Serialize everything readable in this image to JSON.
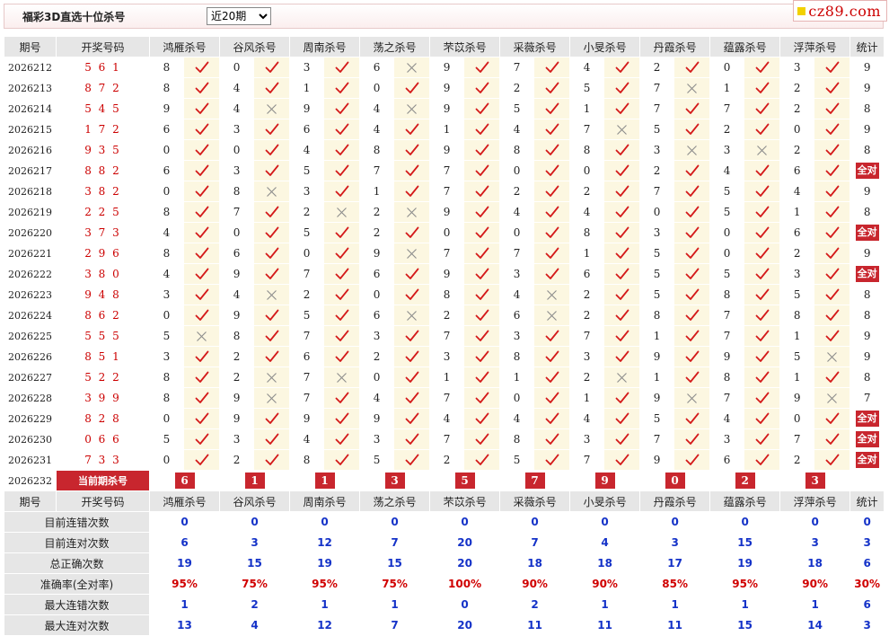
{
  "header": {
    "title": "福彩3D直选十位杀号",
    "select": {
      "selected": "近20期",
      "options": [
        "近20期"
      ]
    },
    "logo_text": "cz89.com"
  },
  "table": {
    "columns": [
      "期号",
      "开奖号码",
      "鸿雁杀号",
      "谷风杀号",
      "周南杀号",
      "荡之杀号",
      "芣苡杀号",
      "采薇杀号",
      "小旻杀号",
      "丹霞杀号",
      "蕴露杀号",
      "浮萍杀号",
      "统计"
    ],
    "full_label": "全对",
    "rows": [
      {
        "period": "2026212",
        "draw": "561",
        "kills": [
          [
            8,
            1
          ],
          [
            0,
            1
          ],
          [
            3,
            1
          ],
          [
            6,
            0
          ],
          [
            9,
            1
          ],
          [
            7,
            1
          ],
          [
            4,
            1
          ],
          [
            2,
            1
          ],
          [
            0,
            1
          ],
          [
            3,
            1
          ]
        ],
        "stat": "9"
      },
      {
        "period": "2026213",
        "draw": "872",
        "kills": [
          [
            8,
            1
          ],
          [
            4,
            1
          ],
          [
            1,
            1
          ],
          [
            0,
            1
          ],
          [
            9,
            1
          ],
          [
            2,
            1
          ],
          [
            5,
            1
          ],
          [
            7,
            0
          ],
          [
            1,
            1
          ],
          [
            2,
            1
          ]
        ],
        "stat": "9"
      },
      {
        "period": "2026214",
        "draw": "545",
        "kills": [
          [
            9,
            1
          ],
          [
            4,
            0
          ],
          [
            9,
            1
          ],
          [
            4,
            0
          ],
          [
            9,
            1
          ],
          [
            5,
            1
          ],
          [
            1,
            1
          ],
          [
            7,
            1
          ],
          [
            7,
            1
          ],
          [
            2,
            1
          ]
        ],
        "stat": "8"
      },
      {
        "period": "2026215",
        "draw": "172",
        "kills": [
          [
            6,
            1
          ],
          [
            3,
            1
          ],
          [
            6,
            1
          ],
          [
            4,
            1
          ],
          [
            1,
            1
          ],
          [
            4,
            1
          ],
          [
            7,
            0
          ],
          [
            5,
            1
          ],
          [
            2,
            1
          ],
          [
            0,
            1
          ]
        ],
        "stat": "9"
      },
      {
        "period": "2026216",
        "draw": "935",
        "kills": [
          [
            0,
            1
          ],
          [
            0,
            1
          ],
          [
            4,
            1
          ],
          [
            8,
            1
          ],
          [
            9,
            1
          ],
          [
            8,
            1
          ],
          [
            8,
            1
          ],
          [
            3,
            0
          ],
          [
            3,
            0
          ],
          [
            2,
            1
          ]
        ],
        "stat": "8"
      },
      {
        "period": "2026217",
        "draw": "882",
        "kills": [
          [
            6,
            1
          ],
          [
            3,
            1
          ],
          [
            5,
            1
          ],
          [
            7,
            1
          ],
          [
            7,
            1
          ],
          [
            0,
            1
          ],
          [
            0,
            1
          ],
          [
            2,
            1
          ],
          [
            4,
            1
          ],
          [
            6,
            1
          ]
        ],
        "stat": "全对"
      },
      {
        "period": "2026218",
        "draw": "382",
        "kills": [
          [
            0,
            1
          ],
          [
            8,
            0
          ],
          [
            3,
            1
          ],
          [
            1,
            1
          ],
          [
            7,
            1
          ],
          [
            2,
            1
          ],
          [
            2,
            1
          ],
          [
            7,
            1
          ],
          [
            5,
            1
          ],
          [
            4,
            1
          ]
        ],
        "stat": "9"
      },
      {
        "period": "2026219",
        "draw": "225",
        "kills": [
          [
            8,
            1
          ],
          [
            7,
            1
          ],
          [
            2,
            0
          ],
          [
            2,
            0
          ],
          [
            9,
            1
          ],
          [
            4,
            1
          ],
          [
            4,
            1
          ],
          [
            0,
            1
          ],
          [
            5,
            1
          ],
          [
            1,
            1
          ]
        ],
        "stat": "8"
      },
      {
        "period": "2026220",
        "draw": "373",
        "kills": [
          [
            4,
            1
          ],
          [
            0,
            1
          ],
          [
            5,
            1
          ],
          [
            2,
            1
          ],
          [
            0,
            1
          ],
          [
            0,
            1
          ],
          [
            8,
            1
          ],
          [
            3,
            1
          ],
          [
            0,
            1
          ],
          [
            6,
            1
          ]
        ],
        "stat": "全对"
      },
      {
        "period": "2026221",
        "draw": "296",
        "kills": [
          [
            8,
            1
          ],
          [
            6,
            1
          ],
          [
            0,
            1
          ],
          [
            9,
            0
          ],
          [
            7,
            1
          ],
          [
            7,
            1
          ],
          [
            1,
            1
          ],
          [
            5,
            1
          ],
          [
            0,
            1
          ],
          [
            2,
            1
          ]
        ],
        "stat": "9"
      },
      {
        "period": "2026222",
        "draw": "380",
        "kills": [
          [
            4,
            1
          ],
          [
            9,
            1
          ],
          [
            7,
            1
          ],
          [
            6,
            1
          ],
          [
            9,
            1
          ],
          [
            3,
            1
          ],
          [
            6,
            1
          ],
          [
            5,
            1
          ],
          [
            5,
            1
          ],
          [
            3,
            1
          ]
        ],
        "stat": "全对"
      },
      {
        "period": "2026223",
        "draw": "948",
        "kills": [
          [
            3,
            1
          ],
          [
            4,
            0
          ],
          [
            2,
            1
          ],
          [
            0,
            1
          ],
          [
            8,
            1
          ],
          [
            4,
            0
          ],
          [
            2,
            1
          ],
          [
            5,
            1
          ],
          [
            8,
            1
          ],
          [
            5,
            1
          ]
        ],
        "stat": "8"
      },
      {
        "period": "2026224",
        "draw": "862",
        "kills": [
          [
            0,
            1
          ],
          [
            9,
            1
          ],
          [
            5,
            1
          ],
          [
            6,
            0
          ],
          [
            2,
            1
          ],
          [
            6,
            0
          ],
          [
            2,
            1
          ],
          [
            8,
            1
          ],
          [
            7,
            1
          ],
          [
            8,
            1
          ]
        ],
        "stat": "8"
      },
      {
        "period": "2026225",
        "draw": "555",
        "kills": [
          [
            5,
            0
          ],
          [
            8,
            1
          ],
          [
            7,
            1
          ],
          [
            3,
            1
          ],
          [
            7,
            1
          ],
          [
            3,
            1
          ],
          [
            7,
            1
          ],
          [
            1,
            1
          ],
          [
            7,
            1
          ],
          [
            1,
            1
          ]
        ],
        "stat": "9"
      },
      {
        "period": "2026226",
        "draw": "851",
        "kills": [
          [
            3,
            1
          ],
          [
            2,
            1
          ],
          [
            6,
            1
          ],
          [
            2,
            1
          ],
          [
            3,
            1
          ],
          [
            8,
            1
          ],
          [
            3,
            1
          ],
          [
            9,
            1
          ],
          [
            9,
            1
          ],
          [
            5,
            0
          ]
        ],
        "stat": "9"
      },
      {
        "period": "2026227",
        "draw": "522",
        "kills": [
          [
            8,
            1
          ],
          [
            2,
            0
          ],
          [
            7,
            0
          ],
          [
            0,
            1
          ],
          [
            1,
            1
          ],
          [
            1,
            1
          ],
          [
            2,
            0
          ],
          [
            1,
            1
          ],
          [
            8,
            1
          ],
          [
            1,
            1
          ]
        ],
        "stat": "8"
      },
      {
        "period": "2026228",
        "draw": "399",
        "kills": [
          [
            8,
            1
          ],
          [
            9,
            0
          ],
          [
            7,
            1
          ],
          [
            4,
            1
          ],
          [
            7,
            1
          ],
          [
            0,
            1
          ],
          [
            1,
            1
          ],
          [
            9,
            0
          ],
          [
            7,
            1
          ],
          [
            9,
            0
          ]
        ],
        "stat": "7"
      },
      {
        "period": "2026229",
        "draw": "828",
        "kills": [
          [
            0,
            1
          ],
          [
            9,
            1
          ],
          [
            9,
            1
          ],
          [
            9,
            1
          ],
          [
            4,
            1
          ],
          [
            4,
            1
          ],
          [
            4,
            1
          ],
          [
            5,
            1
          ],
          [
            4,
            1
          ],
          [
            0,
            1
          ]
        ],
        "stat": "全对"
      },
      {
        "period": "2026230",
        "draw": "066",
        "kills": [
          [
            5,
            1
          ],
          [
            3,
            1
          ],
          [
            4,
            1
          ],
          [
            3,
            1
          ],
          [
            7,
            1
          ],
          [
            8,
            1
          ],
          [
            3,
            1
          ],
          [
            7,
            1
          ],
          [
            3,
            1
          ],
          [
            7,
            1
          ]
        ],
        "stat": "全对"
      },
      {
        "period": "2026231",
        "draw": "733",
        "kills": [
          [
            0,
            1
          ],
          [
            2,
            1
          ],
          [
            8,
            1
          ],
          [
            5,
            1
          ],
          [
            2,
            1
          ],
          [
            5,
            1
          ],
          [
            7,
            1
          ],
          [
            9,
            1
          ],
          [
            6,
            1
          ],
          [
            2,
            1
          ]
        ],
        "stat": "全对"
      }
    ],
    "current": {
      "period": "2026232",
      "label": "当前期杀号",
      "values": [
        "6",
        "1",
        "1",
        "3",
        "5",
        "7",
        "9",
        "0",
        "2",
        "3"
      ]
    }
  },
  "summary": {
    "columns": [
      "期号",
      "开奖号码",
      "鸿雁杀号",
      "谷风杀号",
      "周南杀号",
      "荡之杀号",
      "芣苡杀号",
      "采薇杀号",
      "小旻杀号",
      "丹霞杀号",
      "蕴露杀号",
      "浮萍杀号",
      "统计"
    ],
    "rows": [
      {
        "label": "目前连错次数",
        "values": [
          "0",
          "0",
          "0",
          "0",
          "0",
          "0",
          "0",
          "0",
          "0",
          "0",
          "0"
        ],
        "red": false
      },
      {
        "label": "目前连对次数",
        "values": [
          "6",
          "3",
          "12",
          "7",
          "20",
          "7",
          "4",
          "3",
          "15",
          "3",
          "3"
        ],
        "red": false
      },
      {
        "label": "总正确次数",
        "values": [
          "19",
          "15",
          "19",
          "15",
          "20",
          "18",
          "18",
          "17",
          "19",
          "18",
          "6"
        ],
        "red": false
      },
      {
        "label": "准确率(全对率)",
        "values": [
          "95%",
          "75%",
          "95%",
          "75%",
          "100%",
          "90%",
          "90%",
          "85%",
          "95%",
          "90%",
          "30%"
        ],
        "red": true
      },
      {
        "label": "最大连错次数",
        "values": [
          "1",
          "2",
          "1",
          "1",
          "0",
          "2",
          "1",
          "1",
          "1",
          "1",
          "6"
        ],
        "red": false
      },
      {
        "label": "最大连对次数",
        "values": [
          "13",
          "4",
          "12",
          "7",
          "20",
          "11",
          "11",
          "11",
          "15",
          "14",
          "3"
        ],
        "red": false
      }
    ]
  },
  "colors": {
    "accent_red": "#c8262e",
    "check_red": "#d41a1a",
    "cross_gray": "#8c8c8c",
    "value_blue": "#1432c8",
    "header_gray": "#e6e6e6",
    "mark_bg": "#fcf7e1"
  }
}
